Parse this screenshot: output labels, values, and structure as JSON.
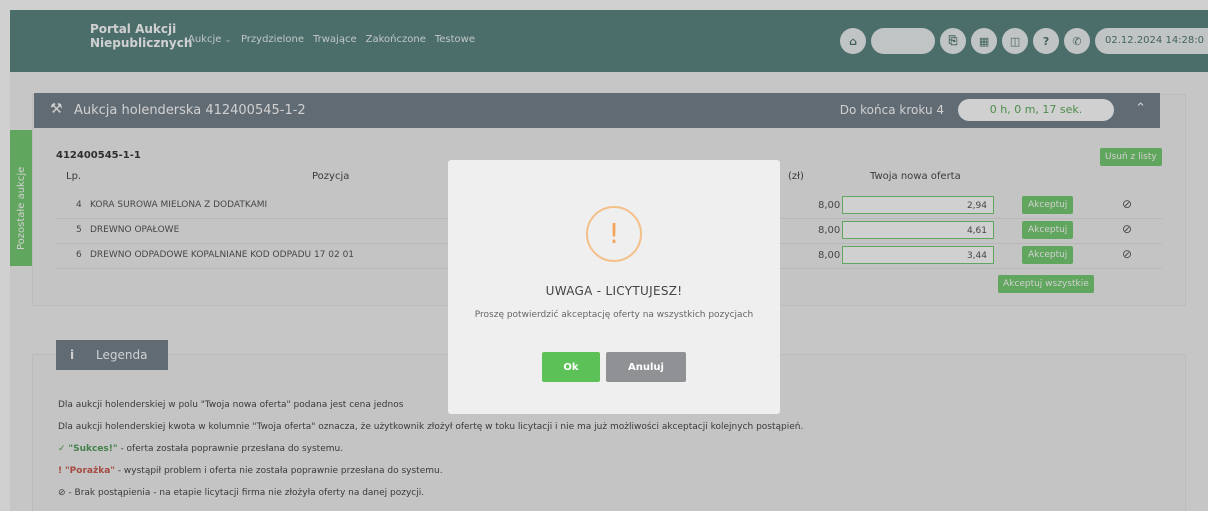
{
  "nav": {
    "brand_line1": "Portal Aukcji",
    "brand_line2": "Niepublicznych",
    "menu": [
      "Aukcje",
      "Przydzielone",
      "Trwające",
      "Zakończone",
      "Testowe"
    ],
    "datetime": "02.12.2024 14:28:0"
  },
  "auction": {
    "title": "Aukcja holenderska 412400545-1-2",
    "step_label": "Do końca kroku 4",
    "timer": "0 h, 0 m, 17 sek.",
    "id": "412400545-1-1",
    "remove_label": "Usuń z listy",
    "headers": {
      "lp": "Lp.",
      "position": "Pozycja",
      "price_suffix": "(zł)",
      "new_offer": "Twoja nowa oferta"
    },
    "rows": [
      {
        "lp": "4",
        "name": "KORA SUROWA MIELONA Z DODATKAMI",
        "price": "8,00",
        "offer": "2,94",
        "accept": "Akceptuj"
      },
      {
        "lp": "5",
        "name": "DREWNO OPAŁOWE",
        "price": "8,00",
        "offer": "4,61",
        "accept": "Akceptuj"
      },
      {
        "lp": "6",
        "name": "DREWNO ODPADOWE KOPALNIANE KOD ODPADU 17 02 01",
        "price": "8,00",
        "offer": "3,44",
        "accept": "Akceptuj"
      }
    ],
    "accept_all": "Akceptuj wszystkie"
  },
  "side_tab": "Pozostałe aukcje",
  "legend": {
    "title": "Legenda",
    "line1": "Dla aukcji holenderskiej w polu \"Twoja nowa oferta\" podana jest cena jednos",
    "line2": "Dla aukcji holenderskiej kwota w kolumnie \"Twoja oferta\" oznacza, że użytkownik złożył ofertę w toku licytacji i nie ma już możliwości akceptacji kolejnych postąpień.",
    "success_label": "\"Sukces!\"",
    "success_text": " - oferta została poprawnie przesłana do systemu.",
    "fail_label": "\"Porażka\"",
    "fail_text": " - wystąpił problem i oferta nie została poprawnie przesłana do systemu.",
    "no_bid_text": " - Brak postąpienia - na etapie licytacji firma nie złożyła oferty na danej pozycji."
  },
  "modal": {
    "title": "UWAGA - LICYTUJESZ!",
    "text": "Proszę potwierdzić akceptację oferty na wszystkich pozycjach",
    "ok": "Ok",
    "cancel": "Anuluj"
  }
}
